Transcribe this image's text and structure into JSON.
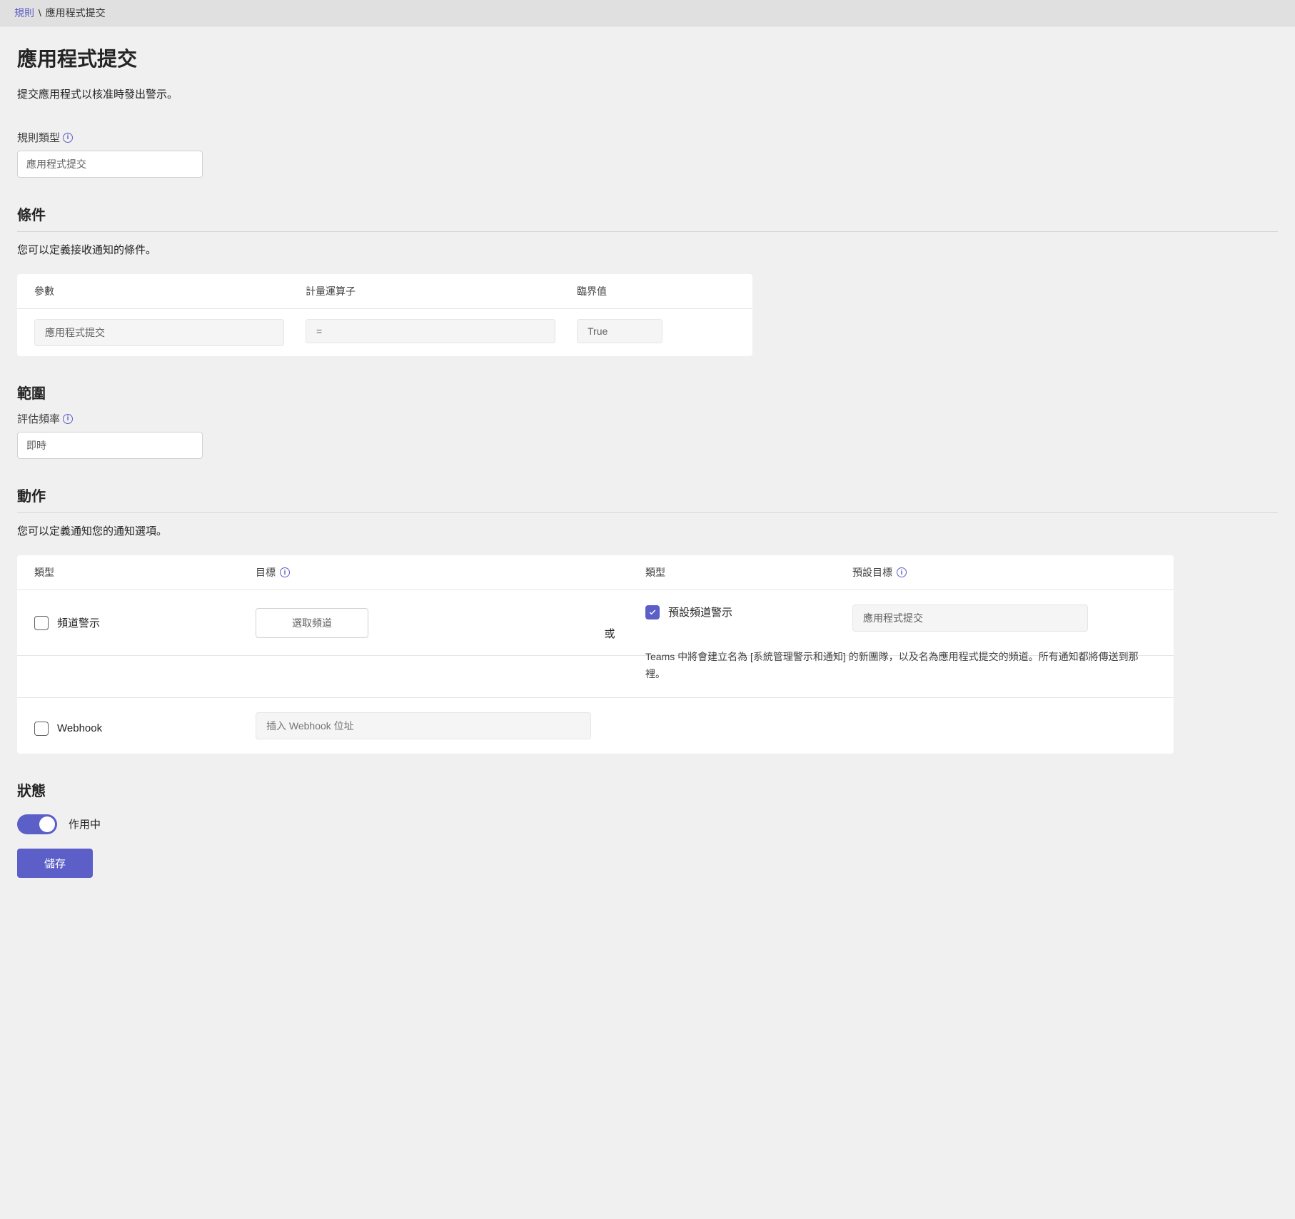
{
  "breadcrumb": {
    "root": "規則",
    "separator": "\\",
    "current": "應用程式提交"
  },
  "page": {
    "title": "應用程式提交",
    "description": "提交應用程式以核准時發出警示。"
  },
  "rule_type": {
    "label": "規則類型",
    "value": "應用程式提交"
  },
  "conditions": {
    "title": "條件",
    "description": "您可以定義接收通知的條件。",
    "headers": {
      "param": "參數",
      "operator": "計量運算子",
      "threshold": "臨界值"
    },
    "row": {
      "param": "應用程式提交",
      "operator": "=",
      "threshold": "True"
    }
  },
  "scope": {
    "title": "範圍",
    "eval_label": "評估頻率",
    "eval_value": "即時"
  },
  "actions": {
    "title": "動作",
    "description": "您可以定義通知您的通知選項。",
    "headers": {
      "type": "類型",
      "target": "目標",
      "type2": "類型",
      "default_target": "預設目標"
    },
    "channel_alert": {
      "label": "頻道警示",
      "select_btn": "選取頻道",
      "or": "或",
      "default_label": "預設頻道警示",
      "default_value": "應用程式提交",
      "helper": "Teams 中將會建立名為 [系統管理警示和通知] 的新團隊，以及名為應用程式提交的頻道。所有通知都將傳送到那裡。"
    },
    "webhook": {
      "label": "Webhook",
      "placeholder": "插入 Webhook 位址"
    }
  },
  "status": {
    "title": "狀態",
    "active_label": "作用中"
  },
  "save_label": "儲存"
}
